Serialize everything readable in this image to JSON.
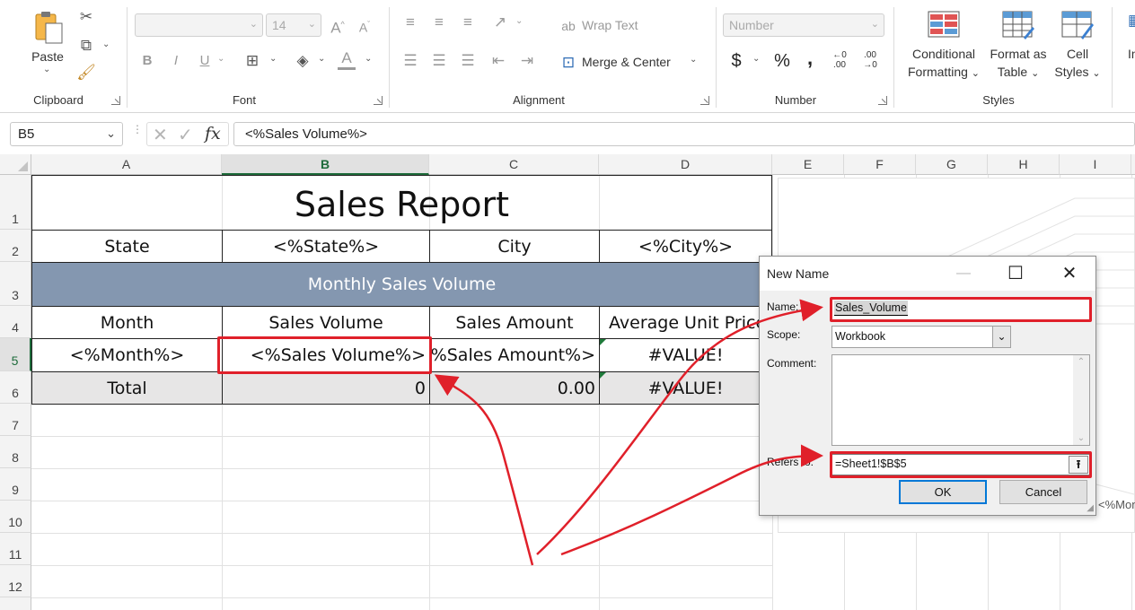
{
  "ribbon": {
    "clipboard": {
      "paste_label": "Paste",
      "group_label": "Clipboard"
    },
    "font": {
      "font_name": "",
      "font_size": "14",
      "group_label": "Font",
      "bold": "B",
      "italic": "I",
      "underline": "U",
      "font_color": "A"
    },
    "alignment": {
      "wrap_text": "Wrap Text",
      "merge_center": "Merge & Center",
      "group_label": "Alignment"
    },
    "number": {
      "format": "Number",
      "currency": "$",
      "percent": "%",
      "comma": ",",
      "inc_decimal": ".00",
      "dec_decimal": ".00",
      "group_label": "Number"
    },
    "styles": {
      "conditional_formatting_line1": "Conditional",
      "conditional_formatting_line2": "Formatting",
      "format_table_line1": "Format as",
      "format_table_line2": "Table",
      "cell_styles_line1": "Cell",
      "cell_styles_line2": "Styles",
      "group_label": "Styles"
    },
    "insert_partial": "In"
  },
  "formula_bar": {
    "name_box": "B5",
    "fx": "fx",
    "formula": "<%Sales Volume%>"
  },
  "columns": [
    "A",
    "B",
    "C",
    "D",
    "E",
    "F",
    "G",
    "H",
    "I"
  ],
  "rows": [
    "1",
    "2",
    "3",
    "4",
    "5",
    "6",
    "7",
    "8",
    "9",
    "10",
    "11",
    "12"
  ],
  "sheet": {
    "title": "Sales Report",
    "state_label": "State",
    "state_value": "<%State%>",
    "city_label": "City",
    "city_value": "<%City%>",
    "section_header": "Monthly Sales Volume",
    "headers": [
      "Month",
      "Sales Volume",
      "Sales Amount",
      "Average Unit Price"
    ],
    "data_row": [
      "<%Month%>",
      "<%Sales Volume%>",
      "<%Sales Amount%>",
      "#VALUE!"
    ],
    "total_row": [
      "Total",
      "0",
      "0.00",
      "#VALUE!"
    ],
    "chart_partial_label": "<%Mon"
  },
  "dialog": {
    "title": "New Name",
    "name_label": "Name:",
    "name_value": "Sales_Volume",
    "scope_label": "Scope:",
    "scope_value": "Workbook",
    "comment_label": "Comment:",
    "refers_label": "Refers to:",
    "refers_value": "=Sheet1!$B$5",
    "ok_label": "OK",
    "cancel_label": "Cancel"
  },
  "colors": {
    "section_header_bg": "#8497b0",
    "total_row_bg": "#e7e6e6",
    "highlight": "#e0202a",
    "accent_green": "#1d6b3a"
  }
}
